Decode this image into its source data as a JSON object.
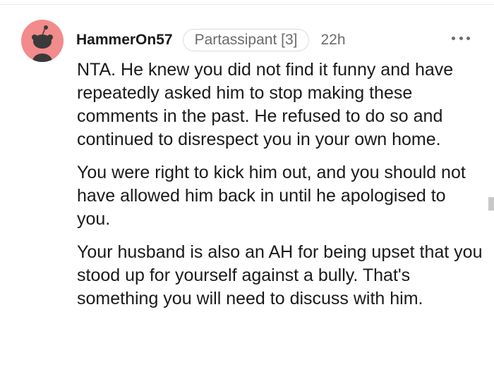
{
  "comment": {
    "username": "HammerOn57",
    "flair": "Partassipant [3]",
    "time": "22h",
    "paragraphs": [
      "NTA. He knew you did not find it funny and have repeatedly asked him to stop making these comments in the past. He refused to do so and continued to disrespect you in your own home.",
      "You were right to kick him out, and you should not have allowed him back in until he apologised to you.",
      "Your husband is also an AH for being upset that you stood up for yourself against a bully. That's something you will need to discuss with him."
    ],
    "avatar_color": "#f28b8b",
    "icons": {
      "avatar": "snoo-avatar-icon",
      "more": "more-options-icon"
    }
  }
}
